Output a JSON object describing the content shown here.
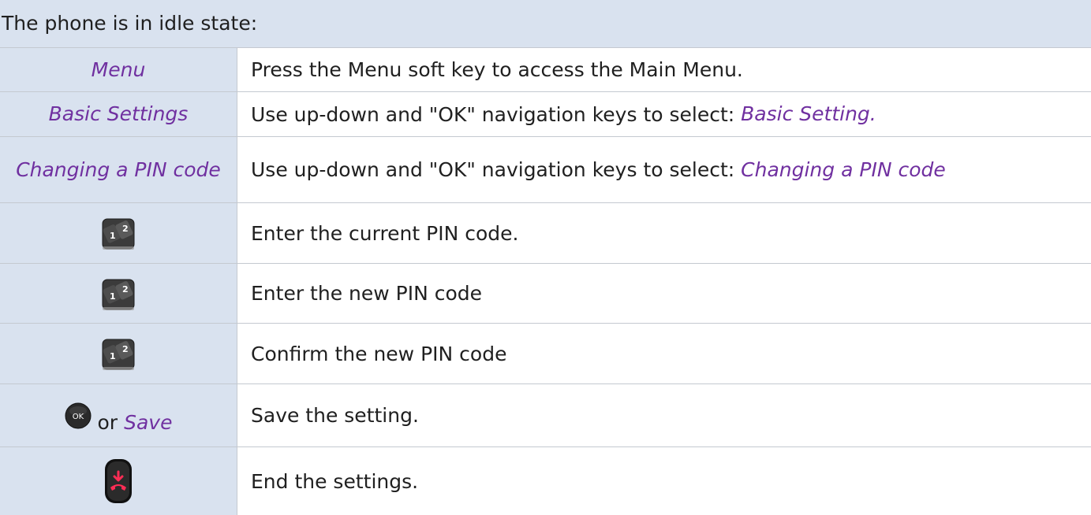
{
  "header": {
    "title": "The phone is in idle state:"
  },
  "rows": [
    {
      "key": "Menu",
      "desc": "Press the Menu soft key to access the Main Menu."
    },
    {
      "key": "Basic Settings",
      "desc": "Use up-down and \"OK\" navigation keys to select: ",
      "highlight": "Basic Setting."
    },
    {
      "key": "Changing a PIN code",
      "desc": "Use up-down and \"OK\" navigation keys to select: ",
      "highlight": "Changing a PIN code"
    },
    {
      "icon": "keypad-icon",
      "desc": "Enter the current PIN code."
    },
    {
      "icon": "keypad-icon",
      "desc": "Enter the new PIN code"
    },
    {
      "icon": "keypad-icon",
      "desc": "Confirm the new PIN code"
    },
    {
      "icon": "ok-key-icon",
      "or_text": "or",
      "key": "Save",
      "ok_label": "OK",
      "desc": "Save the setting."
    },
    {
      "icon": "end-call-key-icon",
      "desc": "End the settings."
    }
  ],
  "colors": {
    "header_bg": "#d9e2ef",
    "softkey_text": "#7030a0",
    "border": "#c4c9d0",
    "end_key_red": "#ff2d55"
  }
}
